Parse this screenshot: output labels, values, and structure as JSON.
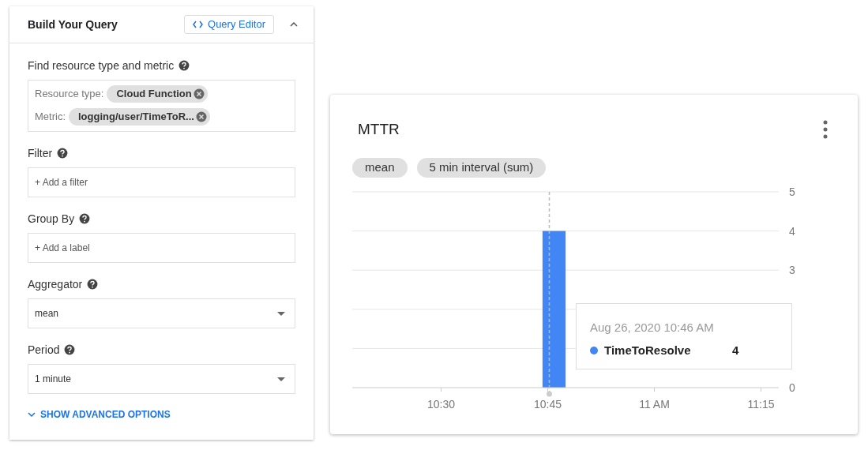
{
  "query_panel": {
    "title": "Build Your Query",
    "editor_button": "Query Editor",
    "expanded": true,
    "sections": [
      {
        "kind": "chips",
        "label": "Find resource type and metric",
        "chips": [
          {
            "label": "Resource type:",
            "value": "Cloud Function"
          },
          {
            "label": "Metric:",
            "value": "logging/user/TimeToR..."
          }
        ]
      },
      {
        "kind": "input",
        "label": "Filter",
        "placeholder": "+ Add a filter"
      },
      {
        "kind": "input",
        "label": "Group By",
        "placeholder": "+ Add a label"
      },
      {
        "kind": "select",
        "label": "Aggregator",
        "value": "mean"
      },
      {
        "kind": "select",
        "label": "Period",
        "value": "1 minute"
      }
    ],
    "advanced_link": "SHOW ADVANCED OPTIONS"
  },
  "chart_card": {
    "title": "MTTR",
    "chips": [
      "mean",
      "5 min interval (sum)"
    ],
    "chart_data": {
      "type": "bar",
      "categories": [
        null,
        null,
        "10:30",
        null,
        null,
        "10:45",
        null,
        null,
        "11 AM",
        null,
        null,
        "11:15"
      ],
      "series": [
        {
          "name": "TimeToResolve",
          "color": "#4285f4",
          "values": [
            null,
            null,
            null,
            null,
            null,
            4,
            null,
            null,
            null,
            null,
            null,
            null
          ]
        }
      ],
      "ylim": [
        0,
        5
      ],
      "yticks": [
        0,
        3,
        4,
        5
      ]
    },
    "tooltip": {
      "time": "Aug 26, 2020 10:46 AM",
      "value": "4"
    }
  }
}
